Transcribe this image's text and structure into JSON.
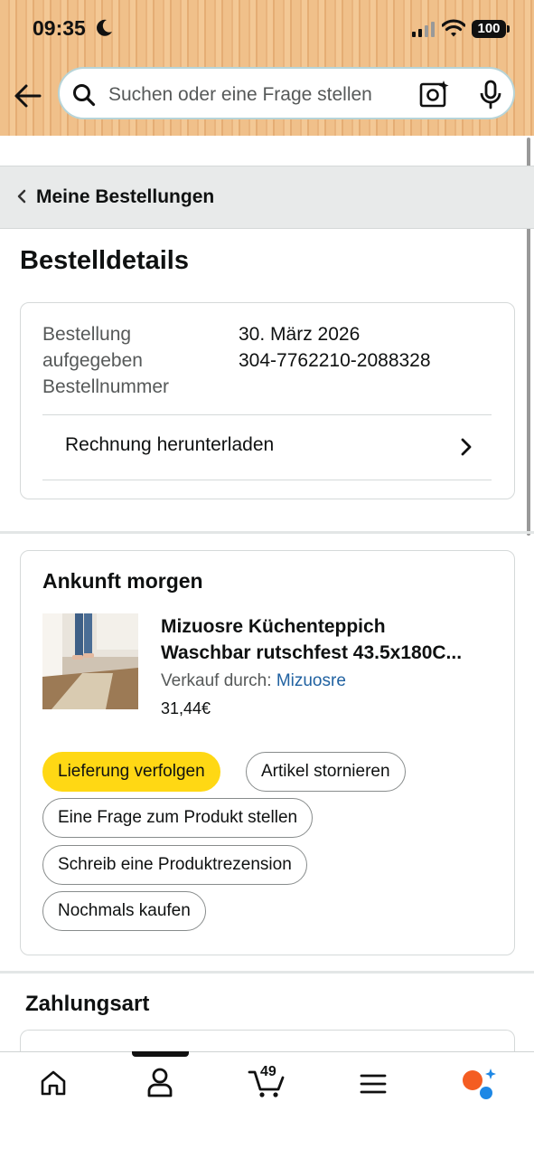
{
  "status_bar": {
    "time": "09:35",
    "battery": "100"
  },
  "search": {
    "placeholder": "Suchen oder eine Frage stellen"
  },
  "breadcrumb": {
    "label": "Meine Bestellungen"
  },
  "page": {
    "title": "Bestelldetails"
  },
  "order_info": {
    "placed_label_line1": "Bestellung",
    "placed_label_line2": "aufgegeben",
    "placed_value": "30. März 2026",
    "number_label": "Bestellnummer",
    "number_value": "304-7762210-2088328",
    "invoice_label": "Rechnung herunterladen"
  },
  "shipment": {
    "arrival": "Ankunft morgen",
    "product_line1": "Mizuosre Küchenteppich",
    "product_line2": "Waschbar rutschfest 43.5x180C...",
    "seller_prefix": "Verkauf durch:",
    "seller_name": "Mizuosre",
    "price": "31,44€",
    "buttons": {
      "track": "Lieferung verfolgen",
      "cancel": "Artikel stornieren",
      "question": "Eine Frage zum Produkt stellen",
      "review": "Schreib eine Produktrezension",
      "buy_again": "Nochmals kaufen"
    }
  },
  "payment": {
    "title": "Zahlungsart"
  },
  "tabbar": {
    "cart_count": "49"
  },
  "icons": [
    "back-arrow-icon",
    "search-icon",
    "camera-icon",
    "microphone-icon",
    "chevron-left-icon",
    "chevron-right-icon",
    "home-icon",
    "account-icon",
    "cart-icon",
    "menu-icon",
    "rufus-assistant-icon"
  ],
  "colors": {
    "primary_button": "#ffd814",
    "link": "#2162a1",
    "header_bg": "#f0c08a"
  }
}
